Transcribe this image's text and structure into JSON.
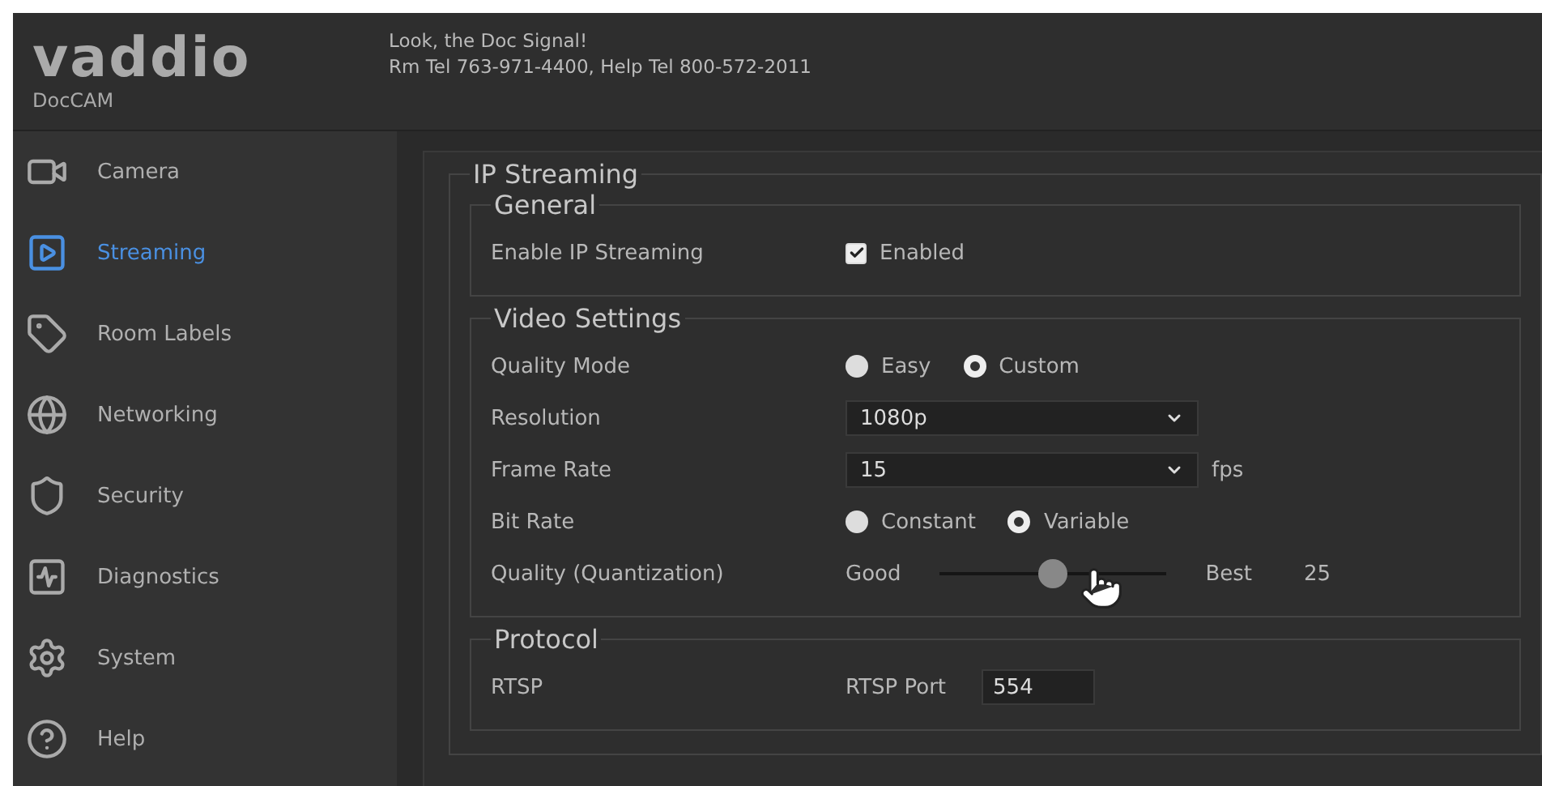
{
  "header": {
    "logo": "vaddio",
    "product": "DocCAM",
    "message": "Look, the Doc Signal!",
    "contact": "Rm Tel 763-971-4400, Help Tel 800-572-2011"
  },
  "sidebar": {
    "items": [
      {
        "label": "Camera",
        "selected": false
      },
      {
        "label": "Streaming",
        "selected": true
      },
      {
        "label": "Room Labels",
        "selected": false
      },
      {
        "label": "Networking",
        "selected": false
      },
      {
        "label": "Security",
        "selected": false
      },
      {
        "label": "Diagnostics",
        "selected": false
      },
      {
        "label": "System",
        "selected": false
      },
      {
        "label": "Help",
        "selected": false
      }
    ]
  },
  "panel": {
    "title": "IP Streaming",
    "sections": [
      {
        "title": "General",
        "rows": [
          {
            "kind": "checkbox",
            "label": "Enable IP Streaming",
            "option": "Enabled",
            "checked": true
          }
        ]
      },
      {
        "title": "Video Settings",
        "rows": [
          {
            "kind": "radio",
            "label": "Quality Mode",
            "options": [
              {
                "label": "Easy",
                "selected": false
              },
              {
                "label": "Custom",
                "selected": true
              }
            ]
          },
          {
            "kind": "select",
            "label": "Resolution",
            "value": "1080p"
          },
          {
            "kind": "select",
            "label": "Frame Rate",
            "value": "15",
            "unit": "fps"
          },
          {
            "kind": "radio",
            "label": "Bit Rate",
            "options": [
              {
                "label": "Constant",
                "selected": false
              },
              {
                "label": "Variable",
                "selected": true
              }
            ]
          },
          {
            "kind": "slider",
            "label": "Quality (Quantization)",
            "min_label": "Good",
            "max_label": "Best",
            "level": 0.5,
            "reading": "25"
          }
        ]
      },
      {
        "title": "Protocol",
        "rows": [
          {
            "kind": "field",
            "label": "RTSP",
            "field_label": "RTSP Port",
            "value": "554"
          }
        ]
      }
    ]
  }
}
